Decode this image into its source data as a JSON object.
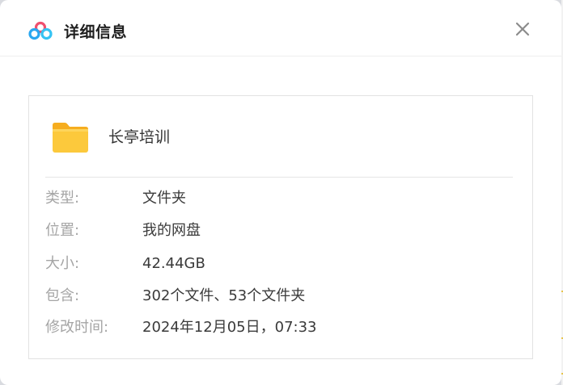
{
  "dialog": {
    "title": "详细信息",
    "close_icon": "close-icon",
    "logo_icon": "baidu-netdisk-logo-icon"
  },
  "item": {
    "name": "长亭培训",
    "icon": "folder-icon"
  },
  "details": [
    {
      "key": "type",
      "label": "类型:",
      "value": "文件夹"
    },
    {
      "key": "location",
      "label": "位置:",
      "value": "我的网盘"
    },
    {
      "key": "size",
      "label": "大小:",
      "value": "42.44GB"
    },
    {
      "key": "contains",
      "label": "包含:",
      "value": "302个文件、53个文件夹"
    },
    {
      "key": "modified",
      "label": "修改时间:",
      "value": "2024年12月05日，07:33"
    }
  ],
  "colors": {
    "folder": "#fcc93c",
    "logo_blue": "#2aa7f0",
    "logo_red": "#f0506e",
    "label_gray": "#a5a5a5"
  }
}
